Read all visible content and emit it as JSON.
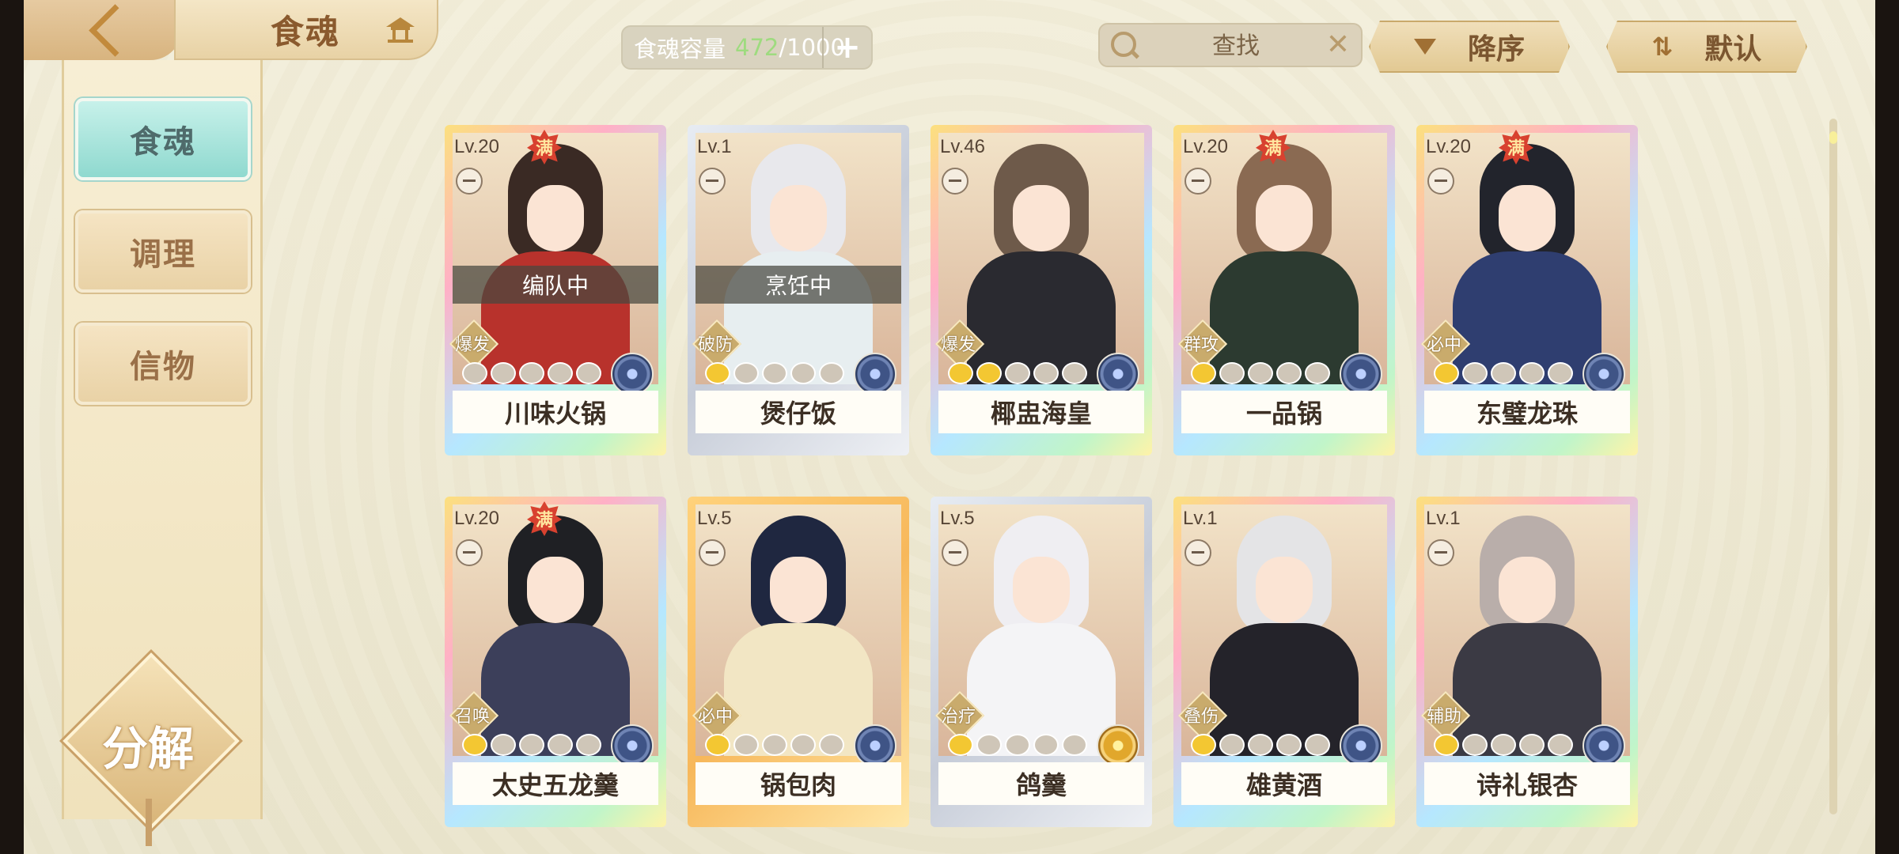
{
  "header": {
    "title": "食魂",
    "capacity_label": "食魂容量",
    "capacity_current": "472",
    "capacity_total": "/1000",
    "capacity_add": "+",
    "search_placeholder": "查找",
    "search_clear": "✕",
    "sort_order_label": "降序",
    "sort_mode_label": "默认"
  },
  "sidebar": {
    "items": [
      {
        "label": "食魂",
        "active": true
      },
      {
        "label": "调理",
        "active": false
      },
      {
        "label": "信物",
        "active": false
      }
    ],
    "decompose_label": "分解"
  },
  "cards": [
    {
      "level": "Lv.20",
      "max": "满",
      "status": "编队中",
      "role": "爆发",
      "stars": 0,
      "name": "川味火锅",
      "frame": "rainbow",
      "element": "blue",
      "hair": "#3a2a24",
      "outfit": "#b8322c"
    },
    {
      "level": "Lv.1",
      "max": "",
      "status": "烹饪中",
      "role": "破防",
      "stars": 1,
      "name": "煲仔饭",
      "frame": "silver",
      "element": "blue",
      "hair": "#e8e8ec",
      "outfit": "#e7eef0"
    },
    {
      "level": "Lv.46",
      "max": "",
      "status": "",
      "role": "爆发",
      "stars": 2,
      "name": "椰盅海皇",
      "frame": "rainbow",
      "element": "blue",
      "hair": "#6e5a4a",
      "outfit": "#2a2a30"
    },
    {
      "level": "Lv.20",
      "max": "满",
      "status": "",
      "role": "群攻",
      "stars": 1,
      "name": "一品锅",
      "frame": "rainbow",
      "element": "blue",
      "hair": "#8a6a52",
      "outfit": "#2c3a30"
    },
    {
      "level": "Lv.20",
      "max": "满",
      "status": "",
      "role": "必中",
      "stars": 1,
      "name": "东璧龙珠",
      "frame": "rainbow",
      "element": "blue",
      "hair": "#22242c",
      "outfit": "#2f3e70"
    },
    {
      "level": "Lv.20",
      "max": "满",
      "status": "",
      "role": "召唤",
      "stars": 1,
      "name": "太史五龙羹",
      "frame": "rainbow",
      "element": "blue",
      "hair": "#1f2024",
      "outfit": "#3c3f5a"
    },
    {
      "level": "Lv.5",
      "max": "",
      "status": "",
      "role": "必中",
      "stars": 1,
      "name": "锅包肉",
      "frame": "gold",
      "element": "blue",
      "hair": "#1f2740",
      "outfit": "#f2e6c4"
    },
    {
      "level": "Lv.5",
      "max": "",
      "status": "",
      "role": "治疗",
      "stars": 1,
      "name": "鸽羹",
      "frame": "silver",
      "element": "gold",
      "hair": "#efeef2",
      "outfit": "#f4f4f6"
    },
    {
      "level": "Lv.1",
      "max": "",
      "status": "",
      "role": "叠伤",
      "stars": 1,
      "name": "雄黄酒",
      "frame": "rainbow",
      "element": "blue",
      "hair": "#e4e4e6",
      "outfit": "#24232a"
    },
    {
      "level": "Lv.1",
      "max": "",
      "status": "",
      "role": "辅助",
      "stars": 1,
      "name": "诗礼银杏",
      "frame": "rainbow",
      "element": "blue",
      "hair": "#b9aeaa",
      "outfit": "#3b3a44"
    }
  ]
}
